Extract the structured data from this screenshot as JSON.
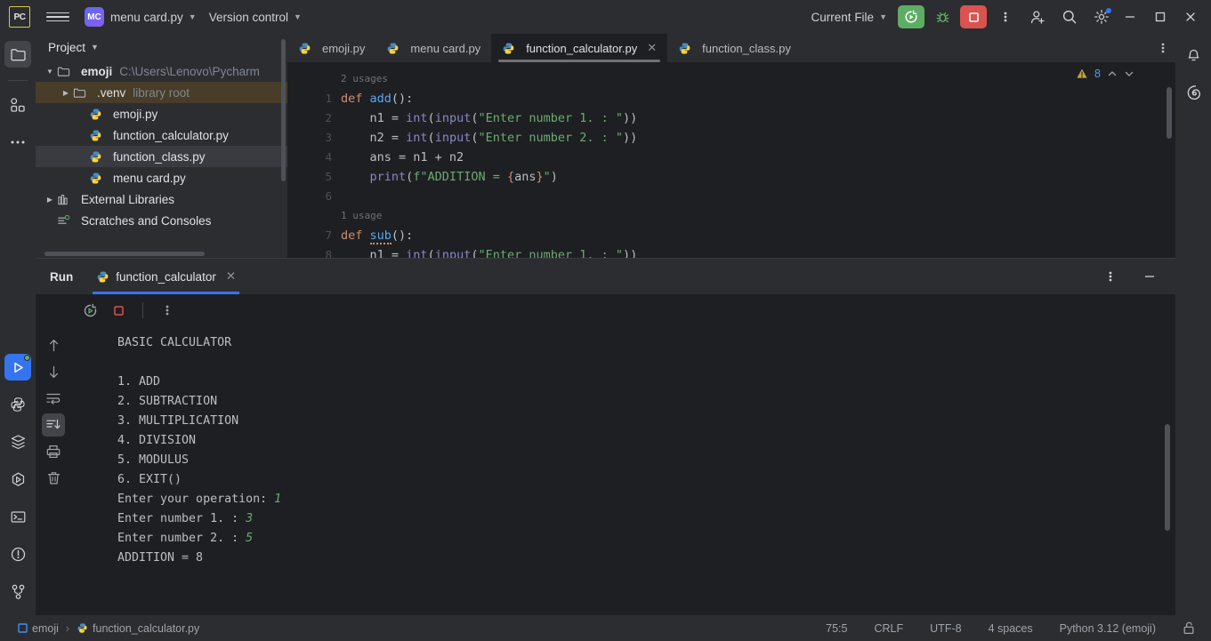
{
  "titlebar": {
    "logo_text": "PC",
    "project_badge": "MC",
    "project_name": "menu card.py",
    "version_control": "Version control",
    "run_config": "Current File",
    "icons": {
      "hamburger": "hamburger-menu-icon",
      "run": "run-icon",
      "debug": "debug-icon",
      "stop": "stop-icon",
      "more": "more-options-icon",
      "account": "add-account-icon",
      "search": "search-icon",
      "settings": "settings-icon",
      "minimize": "minimize-icon",
      "maximize": "maximize-icon",
      "close": "close-icon"
    }
  },
  "left_rail": {
    "items": [
      {
        "name": "project-tool-icon",
        "label": "Project"
      },
      {
        "name": "commit-tool-icon",
        "label": "Commit"
      },
      {
        "name": "more-tools-icon",
        "label": "More tools"
      }
    ],
    "bottom_items": [
      {
        "name": "run-tool-icon",
        "label": "Run"
      },
      {
        "name": "python-console-icon",
        "label": "Python Console"
      },
      {
        "name": "services-icon",
        "label": "Services"
      },
      {
        "name": "python-packages-icon",
        "label": "Python Packages"
      },
      {
        "name": "terminal-icon",
        "label": "Terminal"
      },
      {
        "name": "problems-icon",
        "label": "Problems"
      },
      {
        "name": "version-control-icon",
        "label": "Version Control"
      }
    ]
  },
  "right_rail": {
    "items": [
      {
        "name": "notifications-icon",
        "label": "Notifications"
      },
      {
        "name": "ai-assistant-icon",
        "label": "AI Assistant"
      }
    ]
  },
  "project_panel": {
    "title": "Project",
    "tree": [
      {
        "indent": 1,
        "arrow": "v",
        "icon": "folder-icon",
        "label": "emoji",
        "bold": true,
        "dim": "C:\\Users\\Lenovo\\Pycharm",
        "state": "none"
      },
      {
        "indent": 2,
        "arrow": ">",
        "icon": "folder-icon",
        "label": ".venv",
        "bold": false,
        "dim": "library root",
        "state": "highlight"
      },
      {
        "indent": 3,
        "arrow": "",
        "icon": "python-file-icon",
        "label": "emoji.py",
        "bold": false,
        "dim": "",
        "state": "none"
      },
      {
        "indent": 3,
        "arrow": "",
        "icon": "python-file-icon",
        "label": "function_calculator.py",
        "bold": false,
        "dim": "",
        "state": "none"
      },
      {
        "indent": 3,
        "arrow": "",
        "icon": "python-file-icon",
        "label": "function_class.py",
        "bold": false,
        "dim": "",
        "state": "selected"
      },
      {
        "indent": 3,
        "arrow": "",
        "icon": "python-file-icon",
        "label": "menu card.py",
        "bold": false,
        "dim": "",
        "state": "none"
      },
      {
        "indent": 1,
        "arrow": ">",
        "icon": "library-icon",
        "label": "External Libraries",
        "bold": false,
        "dim": "",
        "state": "none"
      },
      {
        "indent": 1,
        "arrow": "",
        "icon": "scratches-icon",
        "label": "Scratches and Consoles",
        "bold": false,
        "dim": "",
        "state": "none"
      }
    ]
  },
  "editor": {
    "tabs": [
      {
        "label": "emoji.py",
        "active": false,
        "closable": false
      },
      {
        "label": "menu card.py",
        "active": false,
        "closable": false
      },
      {
        "label": "function_calculator.py",
        "active": true,
        "closable": true
      },
      {
        "label": "function_class.py",
        "active": false,
        "closable": false
      }
    ],
    "warning_count": "8",
    "line_numbers": [
      "",
      "1",
      "2",
      "3",
      "4",
      "5",
      "6",
      "",
      "7",
      "8"
    ],
    "code_lines": [
      {
        "type": "usage",
        "text": "2 usages"
      },
      {
        "type": "code",
        "tokens": [
          {
            "c": "kw",
            "t": "def "
          },
          {
            "c": "fn",
            "t": "add"
          },
          {
            "c": "plain",
            "t": "():"
          }
        ]
      },
      {
        "type": "code",
        "tokens": [
          {
            "c": "plain",
            "t": "    n1 = "
          },
          {
            "c": "bi",
            "t": "int"
          },
          {
            "c": "plain",
            "t": "("
          },
          {
            "c": "bi",
            "t": "input"
          },
          {
            "c": "plain",
            "t": "("
          },
          {
            "c": "str",
            "t": "\"Enter number 1. : \""
          },
          {
            "c": "plain",
            "t": "))"
          }
        ]
      },
      {
        "type": "code",
        "tokens": [
          {
            "c": "plain",
            "t": "    n2 = "
          },
          {
            "c": "bi",
            "t": "int"
          },
          {
            "c": "plain",
            "t": "("
          },
          {
            "c": "bi",
            "t": "input"
          },
          {
            "c": "plain",
            "t": "("
          },
          {
            "c": "str",
            "t": "\"Enter number 2. : \""
          },
          {
            "c": "plain",
            "t": "))"
          }
        ]
      },
      {
        "type": "code",
        "tokens": [
          {
            "c": "plain",
            "t": "    ans = n1 + n2"
          }
        ]
      },
      {
        "type": "code",
        "tokens": [
          {
            "c": "plain",
            "t": "    "
          },
          {
            "c": "bi",
            "t": "print"
          },
          {
            "c": "plain",
            "t": "("
          },
          {
            "c": "str",
            "t": "f\"ADDITION = "
          },
          {
            "c": "brace",
            "t": "{"
          },
          {
            "c": "plain",
            "t": "ans"
          },
          {
            "c": "brace",
            "t": "}"
          },
          {
            "c": "str",
            "t": "\""
          },
          {
            "c": "plain",
            "t": ")"
          }
        ]
      },
      {
        "type": "code",
        "tokens": []
      },
      {
        "type": "usage",
        "text": "1 usage"
      },
      {
        "type": "code",
        "tokens": [
          {
            "c": "kw",
            "t": "def "
          },
          {
            "c": "fn squiggle",
            "t": "sub"
          },
          {
            "c": "plain",
            "t": "():"
          }
        ]
      },
      {
        "type": "code",
        "tokens": [
          {
            "c": "plain",
            "t": "    n1 = "
          },
          {
            "c": "bi",
            "t": "int"
          },
          {
            "c": "plain",
            "t": "("
          },
          {
            "c": "bi",
            "t": "input"
          },
          {
            "c": "plain",
            "t": "("
          },
          {
            "c": "str",
            "t": "\"Enter number 1. : \""
          },
          {
            "c": "plain",
            "t": "))"
          }
        ]
      }
    ]
  },
  "run_window": {
    "title": "Run",
    "tab_label": "function_calculator",
    "toolbar_icons": [
      {
        "name": "rerun-icon",
        "label": "Rerun"
      },
      {
        "name": "stop-icon",
        "label": "Stop"
      },
      {
        "name": "more-options-icon",
        "label": "More"
      }
    ],
    "gutter_icons": [
      {
        "name": "scroll-up-icon",
        "label": "Up",
        "selected": false
      },
      {
        "name": "scroll-down-icon",
        "label": "Down",
        "selected": false
      },
      {
        "name": "soft-wrap-icon",
        "label": "Soft-Wrap",
        "selected": false
      },
      {
        "name": "scroll-to-end-icon",
        "label": "Scroll to End",
        "selected": true
      },
      {
        "name": "print-icon",
        "label": "Print",
        "selected": false
      },
      {
        "name": "clear-all-icon",
        "label": "Clear All",
        "selected": false
      }
    ],
    "console_lines": [
      {
        "text": "BASIC CALCULATOR",
        "input": ""
      },
      {
        "text": "",
        "input": ""
      },
      {
        "text": "1. ADD",
        "input": ""
      },
      {
        "text": "2. SUBTRACTION",
        "input": ""
      },
      {
        "text": "3. MULTIPLICATION",
        "input": ""
      },
      {
        "text": "4. DIVISION",
        "input": ""
      },
      {
        "text": "5. MODULUS",
        "input": ""
      },
      {
        "text": "6. EXIT()",
        "input": ""
      },
      {
        "text": "Enter your operation: ",
        "input": "1"
      },
      {
        "text": "Enter number 1. : ",
        "input": "3"
      },
      {
        "text": "Enter number 2. : ",
        "input": "5"
      },
      {
        "text": "ADDITION = 8",
        "input": ""
      }
    ]
  },
  "statusbar": {
    "breadcrumb_project": "emoji",
    "breadcrumb_separator": "›",
    "breadcrumb_file": "function_calculator.py",
    "caret_position": "75:5",
    "line_separator": "CRLF",
    "encoding": "UTF-8",
    "indent": "4 spaces",
    "interpreter": "Python 3.12 (emoji)",
    "lock_icon": "unlocked-icon"
  },
  "colors": {
    "accent_blue": "#3574f0",
    "run_green": "#5fad65",
    "stop_red": "#d9534f",
    "bg_dark": "#1e1f22",
    "bg_panel": "#2b2d30",
    "string_green": "#6aab73",
    "keyword_orange": "#cf8e6d",
    "function_blue": "#56a8f5",
    "builtin_purple": "#8888c6",
    "warning_yellow": "#c9a33c"
  }
}
